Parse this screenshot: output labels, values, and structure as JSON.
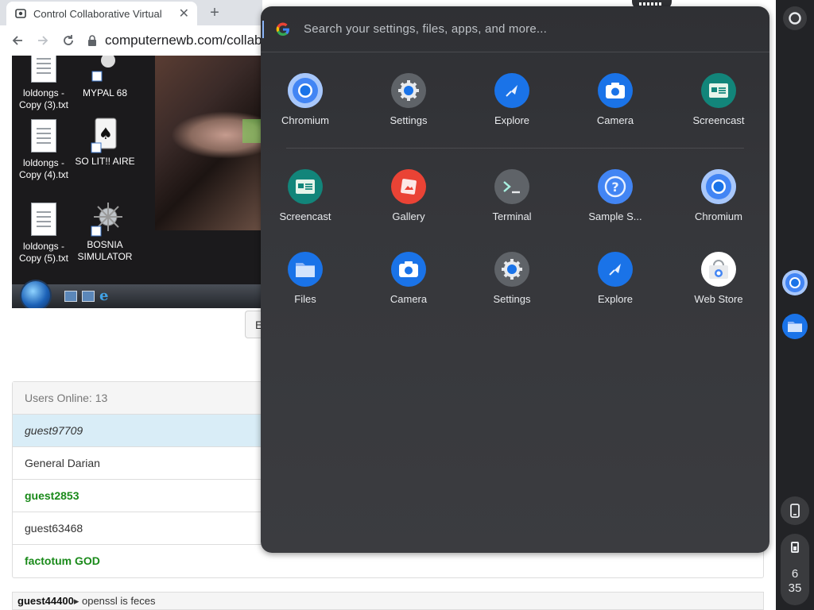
{
  "browser": {
    "tab_title": "Control Collaborative Virtual",
    "url": "computernewb.com/collab"
  },
  "vm": {
    "icons": [
      {
        "label": "loldongs - Copy (3).txt"
      },
      {
        "label": "MYPAL 68"
      },
      {
        "label": "loldongs - Copy (4).txt"
      },
      {
        "label": "SO LIT!! AIRE"
      },
      {
        "label": "loldongs - Copy (5).txt"
      },
      {
        "label": "BOSNIA SIMULATOR"
      }
    ]
  },
  "page": {
    "partial_button": "E",
    "users_header": "Users Online: 13",
    "users": [
      {
        "name": "guest97709",
        "style": "active"
      },
      {
        "name": "General Darian",
        "style": "normal"
      },
      {
        "name": "guest2853",
        "style": "green"
      },
      {
        "name": "guest63468",
        "style": "normal"
      },
      {
        "name": "factotum GOD",
        "style": "green"
      }
    ],
    "chat": {
      "user": "guest44400",
      "sep": "▸",
      "message": "openssl is feces"
    }
  },
  "launcher": {
    "search_placeholder": "Search your settings, files, apps, and more...",
    "row1": [
      {
        "label": "Chromium",
        "icon": "chromium-icon",
        "color": "#4285f4"
      },
      {
        "label": "Settings",
        "icon": "settings-icon",
        "color": "#5f6368"
      },
      {
        "label": "Explore",
        "icon": "explore-icon",
        "color": "#1a73e8"
      },
      {
        "label": "Camera",
        "icon": "camera-icon",
        "color": "#1a73e8"
      },
      {
        "label": "Screencast",
        "icon": "screencast-icon",
        "color": "#12857a"
      }
    ],
    "row2": [
      {
        "label": "Screencast",
        "icon": "screencast-icon",
        "color": "#12857a"
      },
      {
        "label": "Gallery",
        "icon": "gallery-icon",
        "color": "#ea4335"
      },
      {
        "label": "Terminal",
        "icon": "terminal-icon",
        "color": "#5f6368"
      },
      {
        "label": "Sample S...",
        "icon": "help-icon",
        "color": "#4285f4"
      },
      {
        "label": "Chromium",
        "icon": "chromium-icon",
        "color": "#4285f4"
      }
    ],
    "row3": [
      {
        "label": "Files",
        "icon": "files-icon",
        "color": "#1a73e8"
      },
      {
        "label": "Camera",
        "icon": "camera-icon",
        "color": "#1a73e8"
      },
      {
        "label": "Settings",
        "icon": "settings-icon",
        "color": "#5f6368"
      },
      {
        "label": "Explore",
        "icon": "explore-icon",
        "color": "#1a73e8"
      },
      {
        "label": "Web Store",
        "icon": "web-store-icon",
        "color": "#ffffff"
      }
    ]
  },
  "shelf": {
    "time_hour": "6",
    "time_min": "35"
  }
}
